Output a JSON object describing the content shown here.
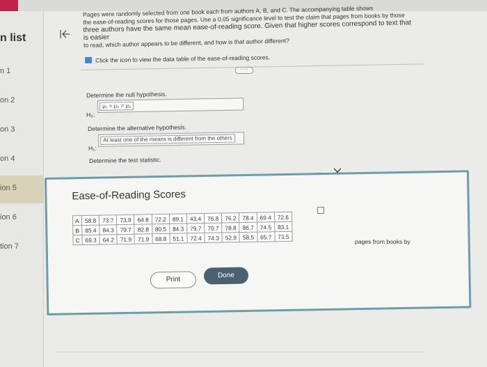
{
  "sidebar": {
    "title": "n list",
    "items": [
      {
        "label": "n 1"
      },
      {
        "label": "on 2"
      },
      {
        "label": "on 3"
      },
      {
        "label": "on 4"
      },
      {
        "label": "ion 5"
      },
      {
        "label": "ion 6"
      },
      {
        "label": "tion 7"
      }
    ]
  },
  "question": {
    "prompt_lines": [
      "Pages were randomly selected from one book each from authors A, B, and C. The accompanying table shows",
      "the ease-of-reading scores for those pages. Use a 0.05 significance level to test the claim that pages from books by those",
      "three authors have the same mean ease-of-reading score. Given that higher scores correspond to text that is easier",
      "to read, which author appears to be different, and how is that author different?"
    ],
    "data_link": "Click the icon to view the data table of the ease-of-reading scores.",
    "ellipsis": "·····",
    "null_prompt": "Determine the null hypothesis.",
    "h0_label": "H₀:",
    "h0_value": "μ₁ = μ₂ = μ₃",
    "alt_prompt": "Determine the alternative hypothesis.",
    "h1_label": "H₁:",
    "h1_value": "At least one of the means is different from the others",
    "stat_prompt": "Determine the test statistic."
  },
  "dialog": {
    "title": "Ease-of-Reading Scores",
    "rows": [
      {
        "label": "A",
        "values": [
          "58.8",
          "73.7",
          "73.9",
          "64.8",
          "72.2",
          "89.1",
          "43.4",
          "76.8",
          "76.2",
          "78.4",
          "69.4",
          "72.6"
        ]
      },
      {
        "label": "B",
        "values": [
          "85.4",
          "84.3",
          "79.7",
          "82.8",
          "80.5",
          "84.3",
          "79.7",
          "70.7",
          "78.8",
          "86.7",
          "74.5",
          "83.1"
        ]
      },
      {
        "label": "C",
        "values": [
          "69.3",
          "64.2",
          "71.9",
          "71.9",
          "68.8",
          "51.1",
          "72.4",
          "74.3",
          "52.9",
          "58.5",
          "65.7",
          "73.5"
        ]
      }
    ],
    "print_label": "Print",
    "done_label": "Done"
  },
  "side_note": "pages from books by"
}
